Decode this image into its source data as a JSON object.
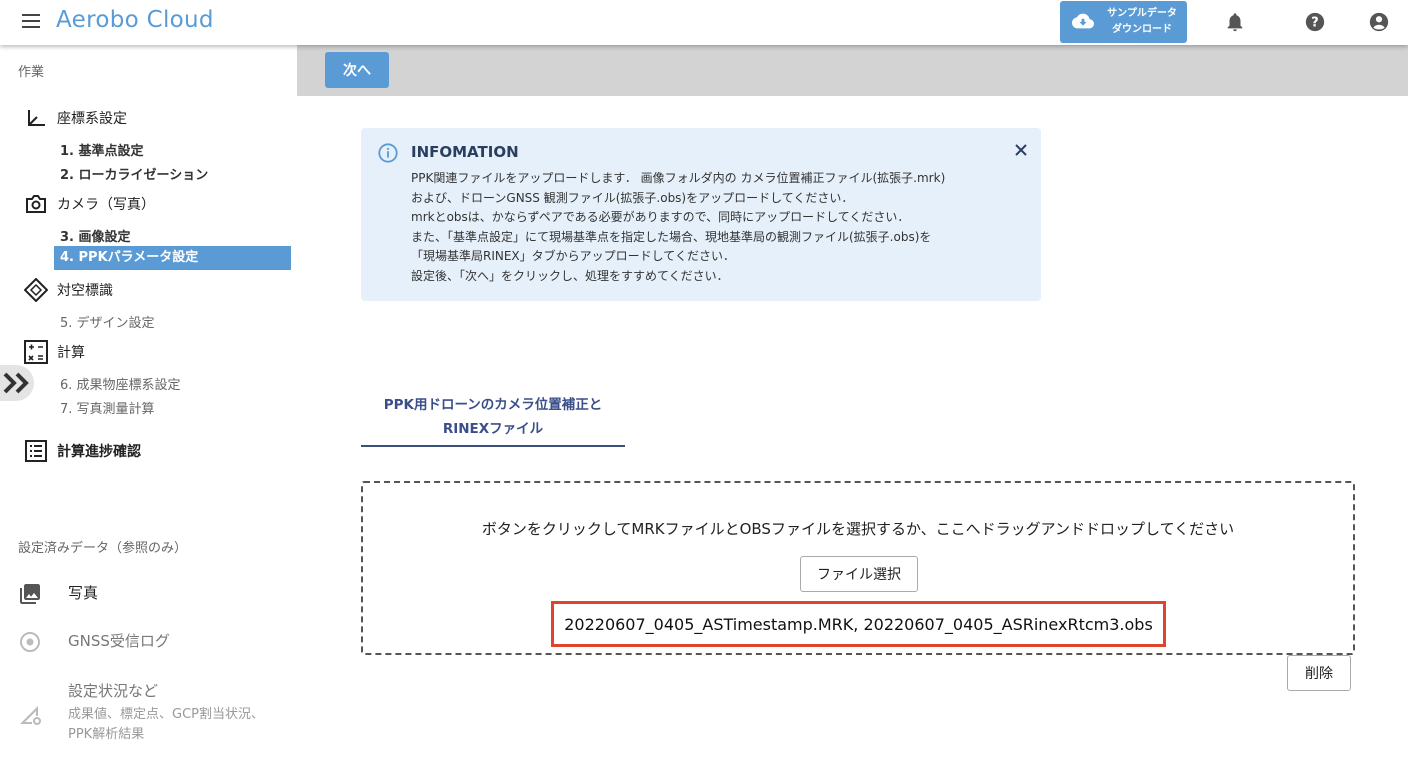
{
  "header": {
    "brand": "Aerobo Cloud",
    "sample_download_line1": "サンプルデータ",
    "sample_download_line2": "ダウンロード",
    "icons": [
      "menu-icon",
      "cloud-download-icon",
      "bell-icon",
      "help-icon",
      "account-icon"
    ]
  },
  "sidebar": {
    "work_label": "作業",
    "groups": [
      {
        "label": "座標系設定",
        "icon": "axis-icon"
      },
      {
        "label": "カメラ（写真）",
        "icon": "camera-icon"
      },
      {
        "label": "対空標識",
        "icon": "target-diamond-icon"
      },
      {
        "label": "計算",
        "icon": "calculator-icon"
      },
      {
        "label": "計算進捗確認",
        "icon": "list-check-icon"
      }
    ],
    "steps": [
      "1. 基準点設定",
      "2. ローカライゼーション",
      "3. 画像設定",
      "4. PPKパラメータ設定",
      "5. デザイン設定",
      "6. 成果物座標系設定",
      "7. 写真測量計算"
    ],
    "active_step": 3,
    "reference_label": "設定済みデータ（参照のみ）",
    "reference_items": [
      {
        "label": "写真",
        "icon": "photo-library-icon"
      },
      {
        "label": "GNSS受信ログ",
        "icon": "gnss-record-icon"
      },
      {
        "label": "設定状況など",
        "sub1": "成果値、標定点、GCP割当状況、",
        "sub2": "PPK解析結果",
        "icon": "settings-signal-icon"
      }
    ]
  },
  "toolbar": {
    "next_label": "次へ"
  },
  "info": {
    "title": "INFOMATION",
    "lines": [
      "PPK関連ファイルをアップロードします．  画像フォルダ内の カメラ位置補正ファイル(拡張子.mrk)",
      "および、ドローンGNSS 観測ファイル(拡張子.obs)をアップロードしてください．",
      "mrkとobsは、かならずペアである必要がありますので、同時にアップロードしてください．",
      "また、「基準点設定」にて現場基準点を指定した場合、現地基準局の観測ファイル(拡張子.obs)を",
      "「現場基準局RINEX」タブからアップロードしてください．",
      "設定後、「次へ」をクリックし、処理をすすめてください．"
    ]
  },
  "tab": {
    "line1": "PPK用ドローンのカメラ位置補正と",
    "line2": "RINEXファイル"
  },
  "dropzone": {
    "message": "ボタンをクリックしてMRKファイルとOBSファイルを選択するか、ここへドラッグアンドドロップしてください",
    "file_button": "ファイル選択",
    "selected_files": "20220607_0405_ASTimestamp.MRK, 20220607_0405_ASRinexRtcm3.obs"
  },
  "delete_label": "削除",
  "colors": {
    "accent": "#5b9bd5",
    "highlight_border": "#e0442d",
    "info_bg": "#e6f0fa"
  }
}
